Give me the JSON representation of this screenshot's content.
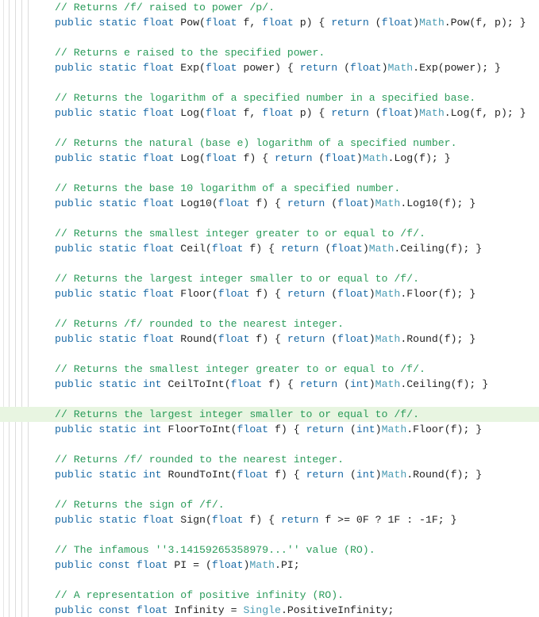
{
  "colors": {
    "keyword": "#1a6aa6",
    "type": "#1a6aa6",
    "class": "#4a9bb3",
    "comment": "#2a9b5a",
    "text": "#222222",
    "highlight_bg": "#e8f5e1",
    "guide": "#dcdcdc"
  },
  "highlighted_line_index": 27,
  "lines": [
    {
      "tokens": [
        {
          "k": "cmt",
          "t": "// Returns /f/ raised to power /p/."
        }
      ]
    },
    {
      "tokens": [
        {
          "k": "kw",
          "t": "public"
        },
        {
          "k": "txt",
          "t": " "
        },
        {
          "k": "kw",
          "t": "static"
        },
        {
          "k": "txt",
          "t": " "
        },
        {
          "k": "type",
          "t": "float"
        },
        {
          "k": "txt",
          "t": " Pow("
        },
        {
          "k": "type",
          "t": "float"
        },
        {
          "k": "txt",
          "t": " f, "
        },
        {
          "k": "type",
          "t": "float"
        },
        {
          "k": "txt",
          "t": " p) { "
        },
        {
          "k": "kw",
          "t": "return"
        },
        {
          "k": "txt",
          "t": " ("
        },
        {
          "k": "type",
          "t": "float"
        },
        {
          "k": "txt",
          "t": ")"
        },
        {
          "k": "cls",
          "t": "Math"
        },
        {
          "k": "txt",
          "t": ".Pow(f, p); }"
        }
      ]
    },
    {
      "blank": true
    },
    {
      "tokens": [
        {
          "k": "cmt",
          "t": "// Returns e raised to the specified power."
        }
      ]
    },
    {
      "tokens": [
        {
          "k": "kw",
          "t": "public"
        },
        {
          "k": "txt",
          "t": " "
        },
        {
          "k": "kw",
          "t": "static"
        },
        {
          "k": "txt",
          "t": " "
        },
        {
          "k": "type",
          "t": "float"
        },
        {
          "k": "txt",
          "t": " Exp("
        },
        {
          "k": "type",
          "t": "float"
        },
        {
          "k": "txt",
          "t": " power) { "
        },
        {
          "k": "kw",
          "t": "return"
        },
        {
          "k": "txt",
          "t": " ("
        },
        {
          "k": "type",
          "t": "float"
        },
        {
          "k": "txt",
          "t": ")"
        },
        {
          "k": "cls",
          "t": "Math"
        },
        {
          "k": "txt",
          "t": ".Exp(power); }"
        }
      ]
    },
    {
      "blank": true
    },
    {
      "tokens": [
        {
          "k": "cmt",
          "t": "// Returns the logarithm of a specified number in a specified base."
        }
      ]
    },
    {
      "tokens": [
        {
          "k": "kw",
          "t": "public"
        },
        {
          "k": "txt",
          "t": " "
        },
        {
          "k": "kw",
          "t": "static"
        },
        {
          "k": "txt",
          "t": " "
        },
        {
          "k": "type",
          "t": "float"
        },
        {
          "k": "txt",
          "t": " Log("
        },
        {
          "k": "type",
          "t": "float"
        },
        {
          "k": "txt",
          "t": " f, "
        },
        {
          "k": "type",
          "t": "float"
        },
        {
          "k": "txt",
          "t": " p) { "
        },
        {
          "k": "kw",
          "t": "return"
        },
        {
          "k": "txt",
          "t": " ("
        },
        {
          "k": "type",
          "t": "float"
        },
        {
          "k": "txt",
          "t": ")"
        },
        {
          "k": "cls",
          "t": "Math"
        },
        {
          "k": "txt",
          "t": ".Log(f, p); }"
        }
      ]
    },
    {
      "blank": true
    },
    {
      "tokens": [
        {
          "k": "cmt",
          "t": "// Returns the natural (base e) logarithm of a specified number."
        }
      ]
    },
    {
      "tokens": [
        {
          "k": "kw",
          "t": "public"
        },
        {
          "k": "txt",
          "t": " "
        },
        {
          "k": "kw",
          "t": "static"
        },
        {
          "k": "txt",
          "t": " "
        },
        {
          "k": "type",
          "t": "float"
        },
        {
          "k": "txt",
          "t": " Log("
        },
        {
          "k": "type",
          "t": "float"
        },
        {
          "k": "txt",
          "t": " f) { "
        },
        {
          "k": "kw",
          "t": "return"
        },
        {
          "k": "txt",
          "t": " ("
        },
        {
          "k": "type",
          "t": "float"
        },
        {
          "k": "txt",
          "t": ")"
        },
        {
          "k": "cls",
          "t": "Math"
        },
        {
          "k": "txt",
          "t": ".Log(f); }"
        }
      ]
    },
    {
      "blank": true
    },
    {
      "tokens": [
        {
          "k": "cmt",
          "t": "// Returns the base 10 logarithm of a specified number."
        }
      ]
    },
    {
      "tokens": [
        {
          "k": "kw",
          "t": "public"
        },
        {
          "k": "txt",
          "t": " "
        },
        {
          "k": "kw",
          "t": "static"
        },
        {
          "k": "txt",
          "t": " "
        },
        {
          "k": "type",
          "t": "float"
        },
        {
          "k": "txt",
          "t": " Log10("
        },
        {
          "k": "type",
          "t": "float"
        },
        {
          "k": "txt",
          "t": " f) { "
        },
        {
          "k": "kw",
          "t": "return"
        },
        {
          "k": "txt",
          "t": " ("
        },
        {
          "k": "type",
          "t": "float"
        },
        {
          "k": "txt",
          "t": ")"
        },
        {
          "k": "cls",
          "t": "Math"
        },
        {
          "k": "txt",
          "t": ".Log10(f); }"
        }
      ]
    },
    {
      "blank": true
    },
    {
      "tokens": [
        {
          "k": "cmt",
          "t": "// Returns the smallest integer greater to or equal to /f/."
        }
      ]
    },
    {
      "tokens": [
        {
          "k": "kw",
          "t": "public"
        },
        {
          "k": "txt",
          "t": " "
        },
        {
          "k": "kw",
          "t": "static"
        },
        {
          "k": "txt",
          "t": " "
        },
        {
          "k": "type",
          "t": "float"
        },
        {
          "k": "txt",
          "t": " Ceil("
        },
        {
          "k": "type",
          "t": "float"
        },
        {
          "k": "txt",
          "t": " f) { "
        },
        {
          "k": "kw",
          "t": "return"
        },
        {
          "k": "txt",
          "t": " ("
        },
        {
          "k": "type",
          "t": "float"
        },
        {
          "k": "txt",
          "t": ")"
        },
        {
          "k": "cls",
          "t": "Math"
        },
        {
          "k": "txt",
          "t": ".Ceiling(f); }"
        }
      ]
    },
    {
      "blank": true
    },
    {
      "tokens": [
        {
          "k": "cmt",
          "t": "// Returns the largest integer smaller to or equal to /f/."
        }
      ]
    },
    {
      "tokens": [
        {
          "k": "kw",
          "t": "public"
        },
        {
          "k": "txt",
          "t": " "
        },
        {
          "k": "kw",
          "t": "static"
        },
        {
          "k": "txt",
          "t": " "
        },
        {
          "k": "type",
          "t": "float"
        },
        {
          "k": "txt",
          "t": " Floor("
        },
        {
          "k": "type",
          "t": "float"
        },
        {
          "k": "txt",
          "t": " f) { "
        },
        {
          "k": "kw",
          "t": "return"
        },
        {
          "k": "txt",
          "t": " ("
        },
        {
          "k": "type",
          "t": "float"
        },
        {
          "k": "txt",
          "t": ")"
        },
        {
          "k": "cls",
          "t": "Math"
        },
        {
          "k": "txt",
          "t": ".Floor(f); }"
        }
      ]
    },
    {
      "blank": true
    },
    {
      "tokens": [
        {
          "k": "cmt",
          "t": "// Returns /f/ rounded to the nearest integer."
        }
      ]
    },
    {
      "tokens": [
        {
          "k": "kw",
          "t": "public"
        },
        {
          "k": "txt",
          "t": " "
        },
        {
          "k": "kw",
          "t": "static"
        },
        {
          "k": "txt",
          "t": " "
        },
        {
          "k": "type",
          "t": "float"
        },
        {
          "k": "txt",
          "t": " Round("
        },
        {
          "k": "type",
          "t": "float"
        },
        {
          "k": "txt",
          "t": " f) { "
        },
        {
          "k": "kw",
          "t": "return"
        },
        {
          "k": "txt",
          "t": " ("
        },
        {
          "k": "type",
          "t": "float"
        },
        {
          "k": "txt",
          "t": ")"
        },
        {
          "k": "cls",
          "t": "Math"
        },
        {
          "k": "txt",
          "t": ".Round(f); }"
        }
      ]
    },
    {
      "blank": true
    },
    {
      "tokens": [
        {
          "k": "cmt",
          "t": "// Returns the smallest integer greater to or equal to /f/."
        }
      ]
    },
    {
      "tokens": [
        {
          "k": "kw",
          "t": "public"
        },
        {
          "k": "txt",
          "t": " "
        },
        {
          "k": "kw",
          "t": "static"
        },
        {
          "k": "txt",
          "t": " "
        },
        {
          "k": "type",
          "t": "int"
        },
        {
          "k": "txt",
          "t": " CeilToInt("
        },
        {
          "k": "type",
          "t": "float"
        },
        {
          "k": "txt",
          "t": " f) { "
        },
        {
          "k": "kw",
          "t": "return"
        },
        {
          "k": "txt",
          "t": " ("
        },
        {
          "k": "type",
          "t": "int"
        },
        {
          "k": "txt",
          "t": ")"
        },
        {
          "k": "cls",
          "t": "Math"
        },
        {
          "k": "txt",
          "t": ".Ceiling(f); }"
        }
      ]
    },
    {
      "blank": true
    },
    {
      "tokens": [
        {
          "k": "cmt",
          "t": "// Returns the largest integer smaller to or equal to /f/."
        }
      ]
    },
    {
      "tokens": [
        {
          "k": "kw",
          "t": "public"
        },
        {
          "k": "txt",
          "t": " "
        },
        {
          "k": "kw",
          "t": "static"
        },
        {
          "k": "txt",
          "t": " "
        },
        {
          "k": "type",
          "t": "int"
        },
        {
          "k": "txt",
          "t": " FloorToInt("
        },
        {
          "k": "type",
          "t": "float"
        },
        {
          "k": "txt",
          "t": " f) { "
        },
        {
          "k": "kw",
          "t": "return"
        },
        {
          "k": "txt",
          "t": " ("
        },
        {
          "k": "type",
          "t": "int"
        },
        {
          "k": "txt",
          "t": ")"
        },
        {
          "k": "cls",
          "t": "Math"
        },
        {
          "k": "txt",
          "t": ".Floor(f); }"
        }
      ]
    },
    {
      "blank": true
    },
    {
      "tokens": [
        {
          "k": "cmt",
          "t": "// Returns /f/ rounded to the nearest integer."
        }
      ]
    },
    {
      "tokens": [
        {
          "k": "kw",
          "t": "public"
        },
        {
          "k": "txt",
          "t": " "
        },
        {
          "k": "kw",
          "t": "static"
        },
        {
          "k": "txt",
          "t": " "
        },
        {
          "k": "type",
          "t": "int"
        },
        {
          "k": "txt",
          "t": " RoundToInt("
        },
        {
          "k": "type",
          "t": "float"
        },
        {
          "k": "txt",
          "t": " f) { "
        },
        {
          "k": "kw",
          "t": "return"
        },
        {
          "k": "txt",
          "t": " ("
        },
        {
          "k": "type",
          "t": "int"
        },
        {
          "k": "txt",
          "t": ")"
        },
        {
          "k": "cls",
          "t": "Math"
        },
        {
          "k": "txt",
          "t": ".Round(f); }"
        }
      ]
    },
    {
      "blank": true
    },
    {
      "tokens": [
        {
          "k": "cmt",
          "t": "// Returns the sign of /f/."
        }
      ]
    },
    {
      "tokens": [
        {
          "k": "kw",
          "t": "public"
        },
        {
          "k": "txt",
          "t": " "
        },
        {
          "k": "kw",
          "t": "static"
        },
        {
          "k": "txt",
          "t": " "
        },
        {
          "k": "type",
          "t": "float"
        },
        {
          "k": "txt",
          "t": " Sign("
        },
        {
          "k": "type",
          "t": "float"
        },
        {
          "k": "txt",
          "t": " f) { "
        },
        {
          "k": "kw",
          "t": "return"
        },
        {
          "k": "txt",
          "t": " f >= 0F ? 1F : -1F; }"
        }
      ]
    },
    {
      "blank": true
    },
    {
      "tokens": [
        {
          "k": "cmt",
          "t": "// The infamous ''3.14159265358979...'' value (RO)."
        }
      ]
    },
    {
      "tokens": [
        {
          "k": "kw",
          "t": "public"
        },
        {
          "k": "txt",
          "t": " "
        },
        {
          "k": "kw",
          "t": "const"
        },
        {
          "k": "txt",
          "t": " "
        },
        {
          "k": "type",
          "t": "float"
        },
        {
          "k": "txt",
          "t": " PI = ("
        },
        {
          "k": "type",
          "t": "float"
        },
        {
          "k": "txt",
          "t": ")"
        },
        {
          "k": "cls",
          "t": "Math"
        },
        {
          "k": "txt",
          "t": ".PI;"
        }
      ]
    },
    {
      "blank": true
    },
    {
      "tokens": [
        {
          "k": "cmt",
          "t": "// A representation of positive infinity (RO)."
        }
      ]
    },
    {
      "tokens": [
        {
          "k": "kw",
          "t": "public"
        },
        {
          "k": "txt",
          "t": " "
        },
        {
          "k": "kw",
          "t": "const"
        },
        {
          "k": "txt",
          "t": " "
        },
        {
          "k": "type",
          "t": "float"
        },
        {
          "k": "txt",
          "t": " Infinity = "
        },
        {
          "k": "cls",
          "t": "Single"
        },
        {
          "k": "txt",
          "t": ".PositiveInfinity;"
        }
      ]
    }
  ]
}
